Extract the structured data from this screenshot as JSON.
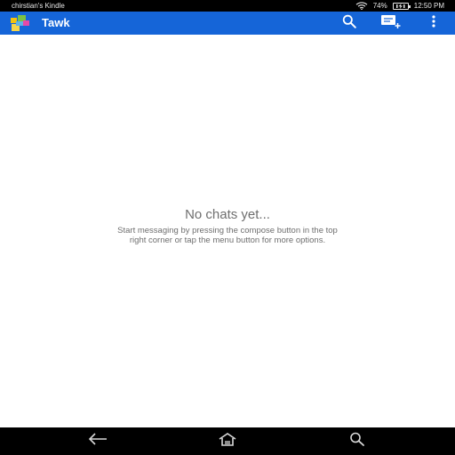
{
  "status_bar": {
    "device_name": "chirstian's Kindle",
    "battery_percent": "74%",
    "time": "12:50 PM",
    "icons": [
      "wifi-icon",
      "battery-charging-icon"
    ]
  },
  "app_bar": {
    "title": "Tawk",
    "background_color": "#1565d8",
    "actions": [
      "search-icon",
      "compose-icon",
      "overflow-menu-icon"
    ]
  },
  "empty_state": {
    "title": "No chats yet...",
    "body": "Start messaging by pressing the compose button in the top right corner or tap the menu button for more options."
  },
  "nav_bar": {
    "buttons": [
      "back-icon",
      "home-icon",
      "search-icon"
    ]
  }
}
